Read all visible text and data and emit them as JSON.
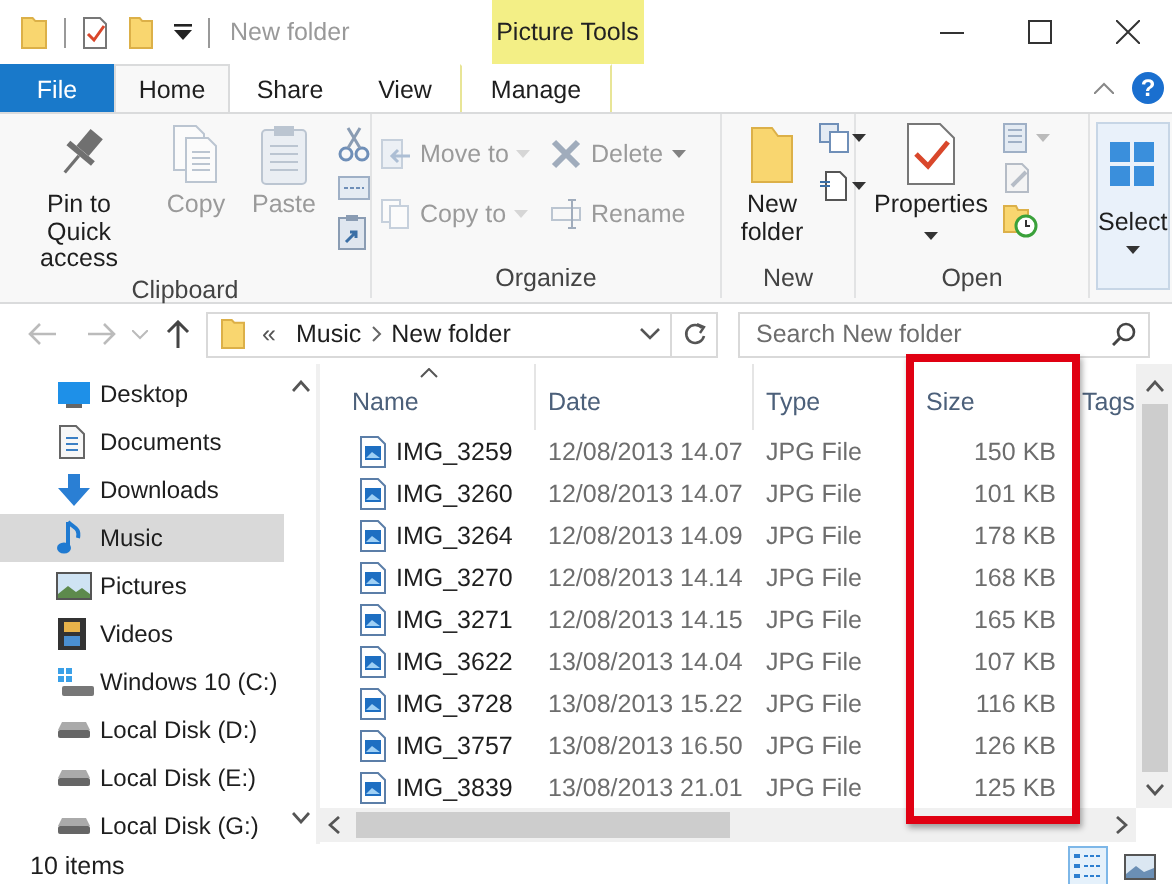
{
  "window": {
    "title": "New folder",
    "contextual_tab_group": "Picture Tools",
    "help_button": "?"
  },
  "tabs": [
    {
      "label": "File",
      "kind": "file",
      "selected": false
    },
    {
      "label": "Home",
      "kind": "standard",
      "selected": true
    },
    {
      "label": "Share",
      "kind": "standard",
      "selected": false
    },
    {
      "label": "View",
      "kind": "standard",
      "selected": false
    },
    {
      "label": "Manage",
      "kind": "contextual",
      "selected": false
    }
  ],
  "ribbon": {
    "groups": [
      {
        "label": "Clipboard",
        "buttons": [
          {
            "label": "Pin to Quick access",
            "disabled": false,
            "menu": false
          },
          {
            "label": "Copy",
            "disabled": true,
            "menu": false
          },
          {
            "label": "Paste",
            "disabled": true,
            "menu": false
          }
        ]
      },
      {
        "label": "Organize",
        "buttons": [
          {
            "label": "Move to",
            "disabled": true,
            "menu": true
          },
          {
            "label": "Copy to",
            "disabled": true,
            "menu": true
          },
          {
            "label": "Delete",
            "disabled": true,
            "menu": true
          },
          {
            "label": "Rename",
            "disabled": true,
            "menu": false
          }
        ]
      },
      {
        "label": "New",
        "buttons": [
          {
            "label": "New folder",
            "disabled": false,
            "menu": false
          }
        ]
      },
      {
        "label": "Open",
        "buttons": [
          {
            "label": "Properties",
            "disabled": false,
            "menu": true
          }
        ]
      }
    ],
    "select": {
      "label": "Select",
      "menu": true
    }
  },
  "address": {
    "overflow": "«",
    "path": [
      "Music",
      "New folder"
    ]
  },
  "search": {
    "placeholder": "Search New folder"
  },
  "sidebar": {
    "items": [
      {
        "label": "Desktop",
        "kind": "desktop",
        "selected": false
      },
      {
        "label": "Documents",
        "kind": "documents",
        "selected": false
      },
      {
        "label": "Downloads",
        "kind": "downloads",
        "selected": false
      },
      {
        "label": "Music",
        "kind": "music",
        "selected": true
      },
      {
        "label": "Pictures",
        "kind": "pictures",
        "selected": false
      },
      {
        "label": "Videos",
        "kind": "videos",
        "selected": false
      },
      {
        "label": "Windows 10 (C:)",
        "kind": "system_drive",
        "selected": false
      },
      {
        "label": "Local Disk (D:)",
        "kind": "drive",
        "selected": false
      },
      {
        "label": "Local Disk (E:)",
        "kind": "drive",
        "selected": false
      },
      {
        "label": "Local Disk (G:)",
        "kind": "drive",
        "selected": false
      }
    ]
  },
  "file_list": {
    "columns": [
      {
        "label": "Name",
        "sorted": true
      },
      {
        "label": "Date",
        "sorted": false
      },
      {
        "label": "Type",
        "sorted": false
      },
      {
        "label": "Size",
        "sorted": false
      },
      {
        "label": "Tags",
        "sorted": false
      }
    ],
    "rows": [
      {
        "name": "IMG_3259",
        "date": "12/08/2013 14.07",
        "type": "JPG File",
        "size": "150 KB"
      },
      {
        "name": "IMG_3260",
        "date": "12/08/2013 14.07",
        "type": "JPG File",
        "size": "101 KB"
      },
      {
        "name": "IMG_3264",
        "date": "12/08/2013 14.09",
        "type": "JPG File",
        "size": "178 KB"
      },
      {
        "name": "IMG_3270",
        "date": "12/08/2013 14.14",
        "type": "JPG File",
        "size": "168 KB"
      },
      {
        "name": "IMG_3271",
        "date": "12/08/2013 14.15",
        "type": "JPG File",
        "size": "165 KB"
      },
      {
        "name": "IMG_3622",
        "date": "13/08/2013 14.04",
        "type": "JPG File",
        "size": "107 KB"
      },
      {
        "name": "IMG_3728",
        "date": "13/08/2013 15.22",
        "type": "JPG File",
        "size": "116 KB"
      },
      {
        "name": "IMG_3757",
        "date": "13/08/2013 16.50",
        "type": "JPG File",
        "size": "126 KB"
      },
      {
        "name": "IMG_3839",
        "date": "13/08/2013 21.01",
        "type": "JPG File",
        "size": "125 KB"
      }
    ]
  },
  "status_bar": {
    "item_count": "10 items",
    "views": [
      {
        "kind": "details",
        "selected": true
      },
      {
        "kind": "thumbnails",
        "selected": false
      }
    ]
  }
}
